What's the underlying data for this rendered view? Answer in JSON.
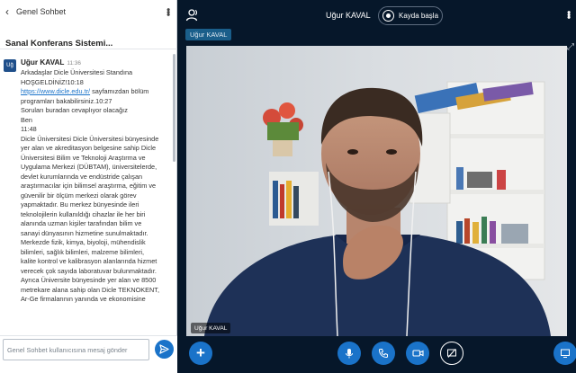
{
  "chat": {
    "title": "Genel Sohbet",
    "welcome": "Sanal Konferans Sistemi...",
    "input_placeholder": "Genel Sohbet kullanıcısına mesaj gönder",
    "message": {
      "avatar": "Uğ",
      "sender": "Uğur KAVAL",
      "time": "11:36",
      "lines": [
        "Arkadaşlar Dicle Üniversitesi Standına",
        "HOŞGELDİNİZ!10:18",
        "sayfamızdan bölüm",
        "programları bakabilirsiniz.10:27",
        "Soruları buradan cevaplıyor olacağız",
        "Ben",
        "11:48",
        "Dicle Üniversitesi Dicle Üniversitesi bünyesinde",
        "yer alan ve akreditasyon belgesine sahip Dicle",
        "Üniversitesi Bilim ve Teknoloji Araştırma ve",
        "Uygulama Merkezi (DÜBTAM), üniversitelerde,",
        "devlet kurumlarında ve endüstride çalışan",
        "araştırmacılar için bilimsel araştırma, eğitim ve",
        "güvenilir bir ölçüm merkezi olarak görev",
        "yapmaktadır. Bu merkez bünyesinde ileri",
        "teknolojilerin kullanıldığı cihazlar ile her biri",
        "alanında uzman kişiler tarafından bilim ve",
        "sanayi dünyasının hizmetine sunulmaktadır.",
        "Merkezde fizik, kimya, biyoloji, mühendislik",
        "bilimleri, sağlık bilimleri, malzeme bilimleri,",
        "kalite kontrol ve kalibrasyon alanlarında hizmet",
        "verecek çok sayıda laboratuvar bulunmaktadır.",
        "Ayrıca Üniversite bünyesinde yer alan ve 8500",
        "metrekare alana sahip olan Dicle TEKNOKENT,",
        "Ar-Ge firmalarının yanında ve ekonomisine"
      ],
      "link": "https://www.dicle.edu.tr/"
    }
  },
  "header": {
    "user_name": "Uğur KAVAL",
    "record_label": "Kayda başla"
  },
  "presenter_badge": "Uğur KAVAL",
  "video": {
    "name_tag": "Uğur KAVAL"
  },
  "colors": {
    "accent": "#1a73c9",
    "background": "#06172a"
  },
  "icons": {
    "users": "users-icon",
    "record": "record-icon",
    "add": "plus-icon",
    "mic": "microphone-icon",
    "phone": "phone-icon",
    "camera": "video-camera-icon",
    "screenshare": "screen-share-icon",
    "fullscreen": "fullscreen-icon",
    "send": "send-icon"
  }
}
